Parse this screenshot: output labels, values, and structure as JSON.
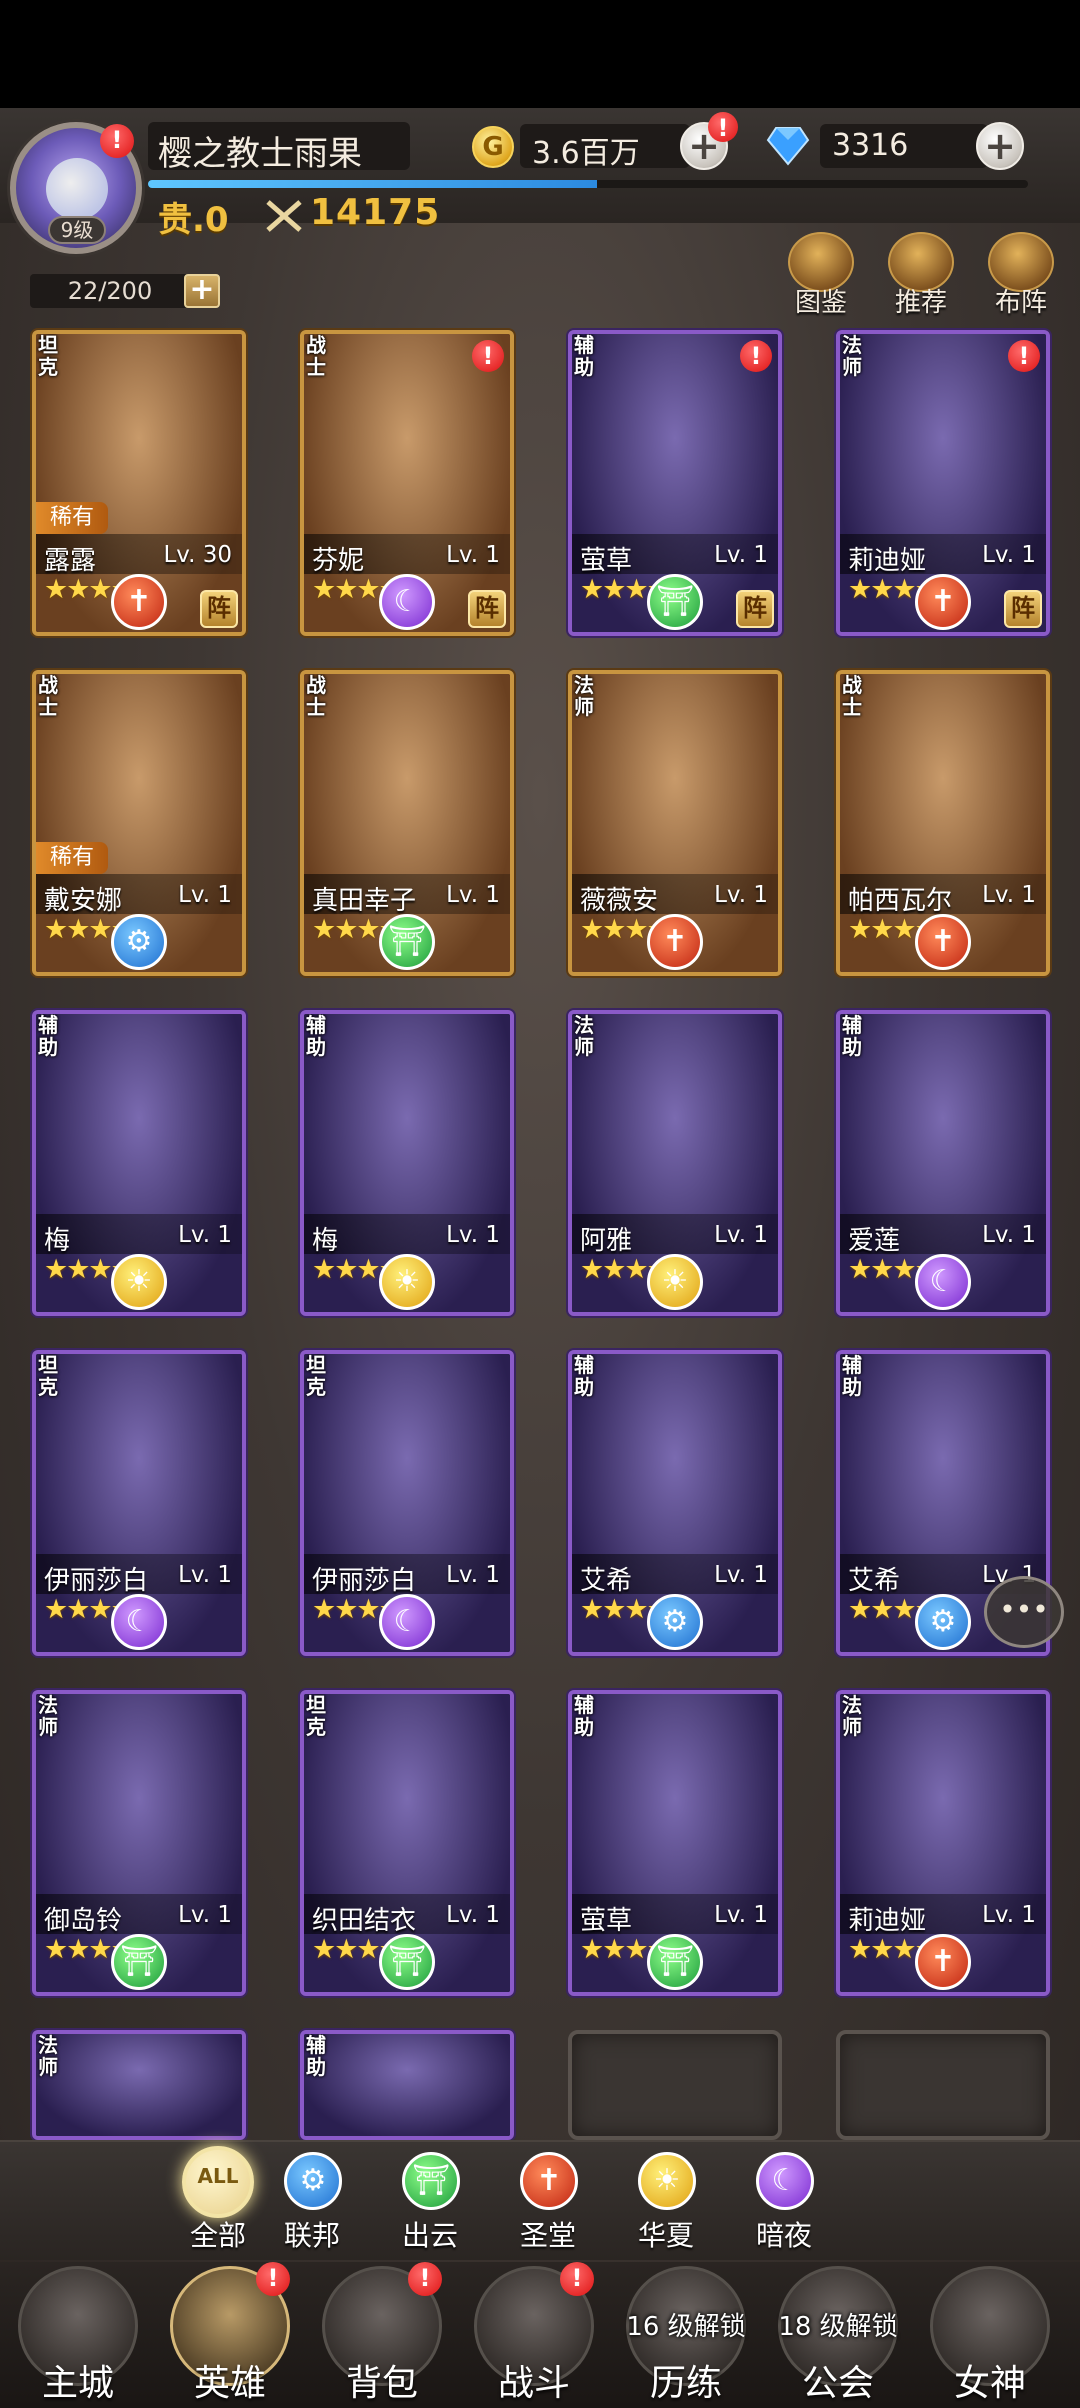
{
  "player": {
    "name": "樱之教士雨果",
    "level": "9级",
    "vip": "贵.0",
    "power": "14175",
    "exp_fraction": 0.51
  },
  "currency": {
    "gold": "3.6百万",
    "gold_symbol": "G",
    "gems": "3316"
  },
  "inventory": {
    "capacity": "22/200",
    "plus": "+"
  },
  "top_actions": [
    {
      "label": "图鉴",
      "icon": "crown-icon"
    },
    {
      "label": "推荐",
      "icon": "thumbs-up-icon"
    },
    {
      "label": "布阵",
      "icon": "chess-knight-icon"
    }
  ],
  "heroes": [
    {
      "role": "坦克",
      "name": "露露",
      "level": "Lv. 30",
      "stars": "★★★★★",
      "rare": "稀有",
      "faction": "shengtang",
      "zhen": "阵",
      "alert": false,
      "frame": "gold"
    },
    {
      "role": "战士",
      "name": "芬妮",
      "level": "Lv. 1",
      "stars": "★★★★",
      "rare": "",
      "faction": "anye",
      "zhen": "阵",
      "alert": true,
      "frame": "gold"
    },
    {
      "role": "辅助",
      "name": "萤草",
      "level": "Lv. 1",
      "stars": "★★★★",
      "rare": "",
      "faction": "chuyun",
      "zhen": "阵",
      "alert": true,
      "frame": "purple"
    },
    {
      "role": "法师",
      "name": "莉迪娅",
      "level": "Lv. 1",
      "stars": "★★★★",
      "rare": "",
      "faction": "shengtang",
      "zhen": "阵",
      "alert": true,
      "frame": "purple"
    },
    {
      "role": "战士",
      "name": "戴安娜",
      "level": "Lv. 1",
      "stars": "★★★★★",
      "rare": "稀有",
      "faction": "lianbang",
      "zhen": "",
      "alert": false,
      "frame": "gold"
    },
    {
      "role": "战士",
      "name": "真田幸子",
      "level": "Lv. 1",
      "stars": "★★★★★",
      "rare": "",
      "faction": "chuyun",
      "zhen": "",
      "alert": false,
      "frame": "gold"
    },
    {
      "role": "法师",
      "name": "薇薇安",
      "level": "Lv. 1",
      "stars": "★★★★★",
      "rare": "",
      "faction": "shengtang",
      "zhen": "",
      "alert": false,
      "frame": "gold"
    },
    {
      "role": "战士",
      "name": "帕西瓦尔",
      "level": "Lv. 1",
      "stars": "★★★★★",
      "rare": "",
      "faction": "shengtang",
      "zhen": "",
      "alert": false,
      "frame": "gold"
    },
    {
      "role": "辅助",
      "name": "梅",
      "level": "Lv. 1",
      "stars": "★★★★",
      "rare": "",
      "faction": "huaxia",
      "zhen": "",
      "alert": false,
      "frame": "purple"
    },
    {
      "role": "辅助",
      "name": "梅",
      "level": "Lv. 1",
      "stars": "★★★★",
      "rare": "",
      "faction": "huaxia",
      "zhen": "",
      "alert": false,
      "frame": "purple"
    },
    {
      "role": "法师",
      "name": "阿雅",
      "level": "Lv. 1",
      "stars": "★★★★",
      "rare": "",
      "faction": "huaxia",
      "zhen": "",
      "alert": false,
      "frame": "purple"
    },
    {
      "role": "辅助",
      "name": "爱莲",
      "level": "Lv. 1",
      "stars": "★★★★",
      "rare": "",
      "faction": "anye",
      "zhen": "",
      "alert": false,
      "frame": "purple"
    },
    {
      "role": "坦克",
      "name": "伊丽莎白",
      "level": "Lv. 1",
      "stars": "★★★★",
      "rare": "",
      "faction": "anye",
      "zhen": "",
      "alert": false,
      "frame": "purple"
    },
    {
      "role": "坦克",
      "name": "伊丽莎白",
      "level": "Lv. 1",
      "stars": "★★★★",
      "rare": "",
      "faction": "anye",
      "zhen": "",
      "alert": false,
      "frame": "purple"
    },
    {
      "role": "辅助",
      "name": "艾希",
      "level": "Lv. 1",
      "stars": "★★★★",
      "rare": "",
      "faction": "lianbang",
      "zhen": "",
      "alert": false,
      "frame": "purple"
    },
    {
      "role": "辅助",
      "name": "艾希",
      "level": "Lv. 1",
      "stars": "★★★★",
      "rare": "",
      "faction": "lianbang",
      "zhen": "",
      "alert": false,
      "frame": "purple"
    },
    {
      "role": "法师",
      "name": "御岛铃",
      "level": "Lv. 1",
      "stars": "★★★★",
      "rare": "",
      "faction": "chuyun",
      "zhen": "",
      "alert": false,
      "frame": "purple"
    },
    {
      "role": "坦克",
      "name": "织田结衣",
      "level": "Lv. 1",
      "stars": "★★★★",
      "rare": "",
      "faction": "chuyun",
      "zhen": "",
      "alert": false,
      "frame": "purple"
    },
    {
      "role": "辅助",
      "name": "萤草",
      "level": "Lv. 1",
      "stars": "★★★★",
      "rare": "",
      "faction": "chuyun",
      "zhen": "",
      "alert": false,
      "frame": "purple"
    },
    {
      "role": "法师",
      "name": "莉迪娅",
      "level": "Lv. 1",
      "stars": "★★★★",
      "rare": "",
      "faction": "shengtang",
      "zhen": "",
      "alert": false,
      "frame": "purple"
    },
    {
      "role": "法师",
      "name": "",
      "level": "",
      "stars": "",
      "rare": "",
      "faction": "",
      "zhen": "",
      "alert": false,
      "frame": "purple"
    },
    {
      "role": "辅助",
      "name": "",
      "level": "",
      "stars": "",
      "rare": "",
      "faction": "",
      "zhen": "",
      "alert": false,
      "frame": "purple"
    }
  ],
  "empty_slots": 2,
  "filters": [
    {
      "label": "全部",
      "badge": "ALL",
      "key": "all",
      "icon": "all-icon",
      "active": true
    },
    {
      "label": "联邦",
      "key": "lianbang",
      "icon": "gear-icon",
      "active": false
    },
    {
      "label": "出云",
      "key": "chuyun",
      "icon": "torii-gate-icon",
      "active": false
    },
    {
      "label": "圣堂",
      "key": "shengtang",
      "icon": "cross-icon",
      "active": false
    },
    {
      "label": "华夏",
      "key": "huaxia",
      "icon": "sun-swirl-icon",
      "active": false
    },
    {
      "label": "暗夜",
      "key": "anye",
      "icon": "crescent-moon-icon",
      "active": false
    }
  ],
  "nav": [
    {
      "label": "主城",
      "icon": "castle-icon",
      "lock": "",
      "alert": false,
      "active": false
    },
    {
      "label": "英雄",
      "icon": "hooded-hero-icon",
      "lock": "",
      "alert": true,
      "active": true
    },
    {
      "label": "背包",
      "icon": "backpack-icon",
      "lock": "",
      "alert": true,
      "active": false
    },
    {
      "label": "战斗",
      "icon": "crossed-swords-icon",
      "lock": "",
      "alert": true,
      "active": false
    },
    {
      "label": "历练",
      "icon": "map-pin-icon",
      "lock": "16 级解锁",
      "alert": false,
      "active": false
    },
    {
      "label": "公会",
      "icon": "guild-crest-icon",
      "lock": "18 级解锁",
      "alert": false,
      "active": false
    },
    {
      "label": "女神",
      "icon": "goddess-icon",
      "lock": "",
      "alert": false,
      "active": false
    }
  ],
  "chat_icon": "chat-bubble-icon",
  "colors": {
    "gold_frame": "#c89540",
    "purple_frame": "#8a5ac8",
    "accent_gold_text": "#f0c040",
    "alert_red": "#dd1111"
  }
}
